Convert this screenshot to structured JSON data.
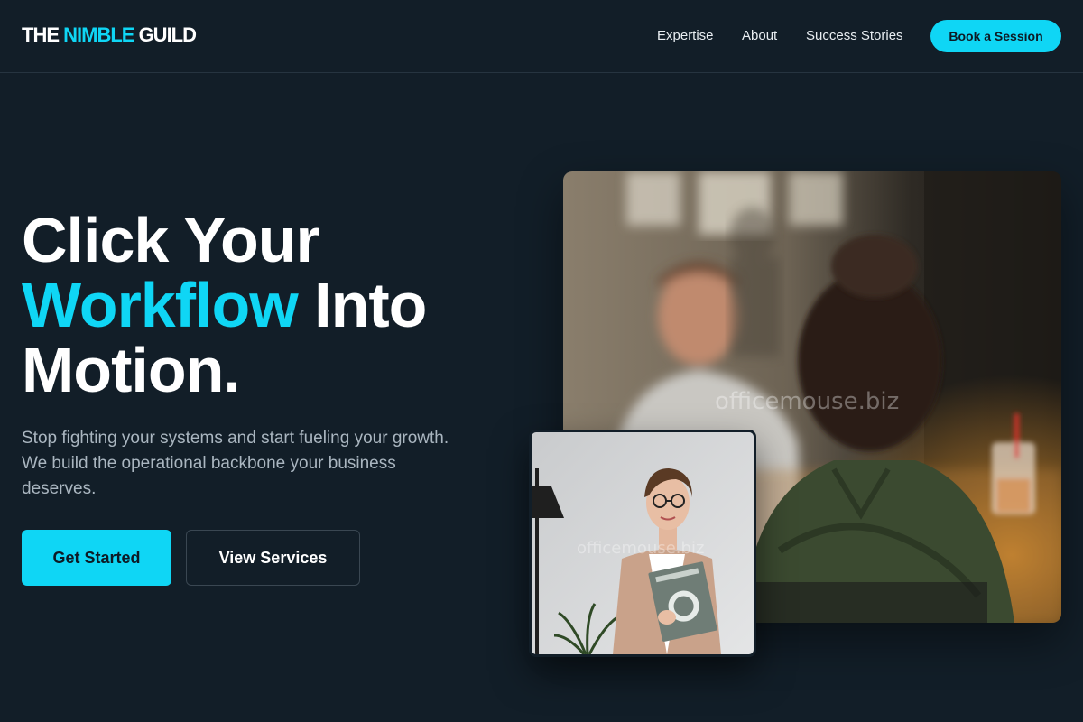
{
  "brand": {
    "logo_part1": "THE ",
    "logo_accent": "NIMBLE",
    "logo_part2": " GUILD",
    "accent_color": "#0fd6f5",
    "background_color": "#121e28"
  },
  "nav": {
    "links": [
      "Expertise",
      "About",
      "Success Stories"
    ],
    "cta_label": "Book a Session"
  },
  "hero": {
    "line1": "Click Your",
    "line2_accent": "Workflow",
    "line2_rest": " Into",
    "line3": "Motion.",
    "subtext": "Stop fighting your systems and start fueling your growth. We build the operational backbone your business deserves.",
    "primary_button": "Get Started",
    "secondary_button": "View Services"
  },
  "images": {
    "main_watermark": "officemouse.biz",
    "small_watermark": "officemouse.biz"
  }
}
